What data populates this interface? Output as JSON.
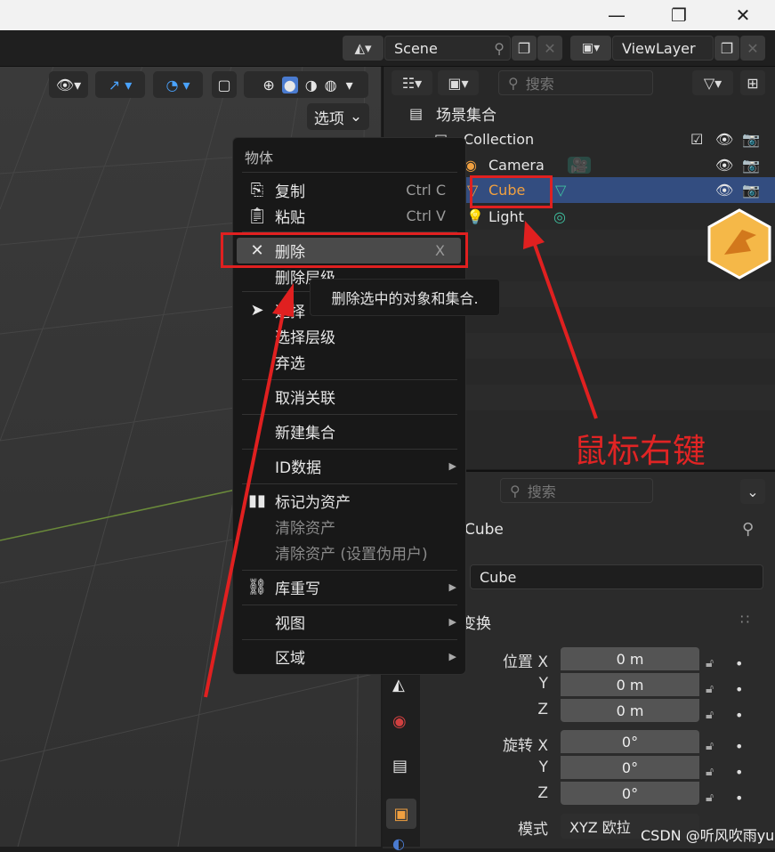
{
  "window": {
    "minimize": "—",
    "maximize": "❐",
    "close": "✕"
  },
  "topbar": {
    "scene_label": "Scene",
    "viewlayer_label": "ViewLayer"
  },
  "viewport": {
    "options_label": "选项"
  },
  "outliner": {
    "search_placeholder": "搜索",
    "root_label": "场景集合",
    "items": [
      {
        "label": "Collection"
      },
      {
        "label": "Camera"
      },
      {
        "label": "Cube"
      },
      {
        "label": "Light"
      }
    ]
  },
  "context_menu": {
    "title": "物体",
    "items": [
      {
        "label": "复制",
        "shortcut": "Ctrl C"
      },
      {
        "label": "粘贴",
        "shortcut": "Ctrl V"
      },
      {
        "label": "删除",
        "shortcut": "X"
      },
      {
        "label": "删除层级"
      },
      {
        "label": "选择"
      },
      {
        "label": "选择层级"
      },
      {
        "label": "弃选"
      },
      {
        "label": "取消关联"
      },
      {
        "label": "新建集合"
      },
      {
        "label": "ID数据"
      },
      {
        "label": "标记为资产"
      },
      {
        "label": "清除资产"
      },
      {
        "label": "清除资产 (设置伪用户)"
      },
      {
        "label": "库重写"
      },
      {
        "label": "视图"
      },
      {
        "label": "区域"
      }
    ],
    "tooltip": "删除选中的对象和集合."
  },
  "properties": {
    "search_placeholder": "搜索",
    "object_name": "Cube",
    "name_field": "Cube",
    "section_title": "变换",
    "location_label": "位置 X",
    "rotation_label": "旋转 X",
    "axis_y": "Y",
    "axis_z": "Z",
    "location": [
      "0 m",
      "0 m",
      "0 m"
    ],
    "rotation": [
      "0°",
      "0°",
      "0°"
    ],
    "mode_label": "模式",
    "mode_value": "XYZ 欧拉"
  },
  "annotation": {
    "text": "鼠标右键"
  },
  "watermark": {
    "text": "CSDN @听风吹雨yu"
  },
  "colors": {
    "accent": "#e02020",
    "selected_row": "#334d80",
    "cube_orange": "#f0a040",
    "green_icon": "#3fc0a0"
  }
}
